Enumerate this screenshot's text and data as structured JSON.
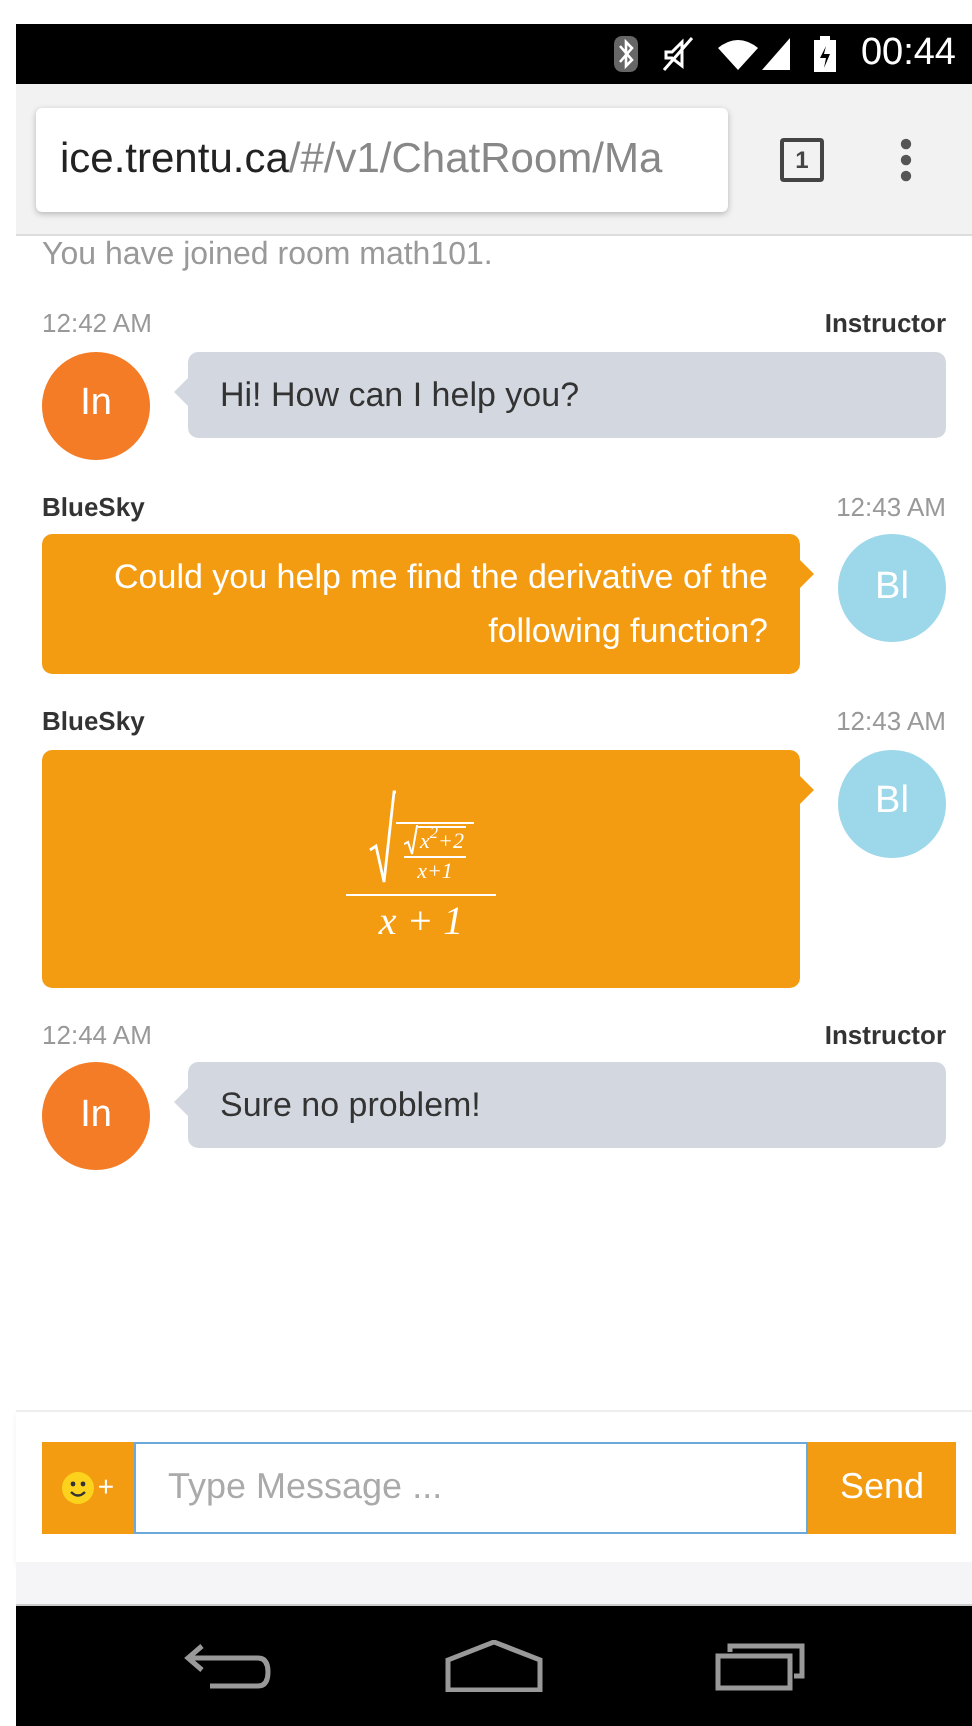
{
  "status_bar": {
    "time": "00:44"
  },
  "browser": {
    "url_host": "ice.trentu.ca",
    "url_path": "/#/v1/ChatRoom/Ma",
    "tab_count": "1"
  },
  "system_message": "You have joined room math101.",
  "messages": [
    {
      "outgoing": false,
      "kind": "text",
      "time": "12:42 AM",
      "sender": "Instructor",
      "avatar": "In",
      "text": "Hi! How can I help you?"
    },
    {
      "outgoing": true,
      "kind": "text",
      "time": "12:43 AM",
      "sender": "BlueSky",
      "avatar": "Bl",
      "text": "Could you help me find the derivative of the following function?"
    },
    {
      "outgoing": true,
      "kind": "formula",
      "time": "12:43 AM",
      "sender": "BlueSky",
      "avatar": "Bl",
      "formula": {
        "inner_root": "x$^{2}$+2",
        "inner_denominator": "x+1",
        "denominator": "x + 1"
      }
    },
    {
      "outgoing": false,
      "kind": "text",
      "time": "12:44 AM",
      "sender": "Instructor",
      "avatar": "In",
      "text": "Sure no problem!"
    }
  ],
  "composer": {
    "emoji_plus": "+",
    "placeholder": "Type Message ...",
    "send": "Send"
  }
}
